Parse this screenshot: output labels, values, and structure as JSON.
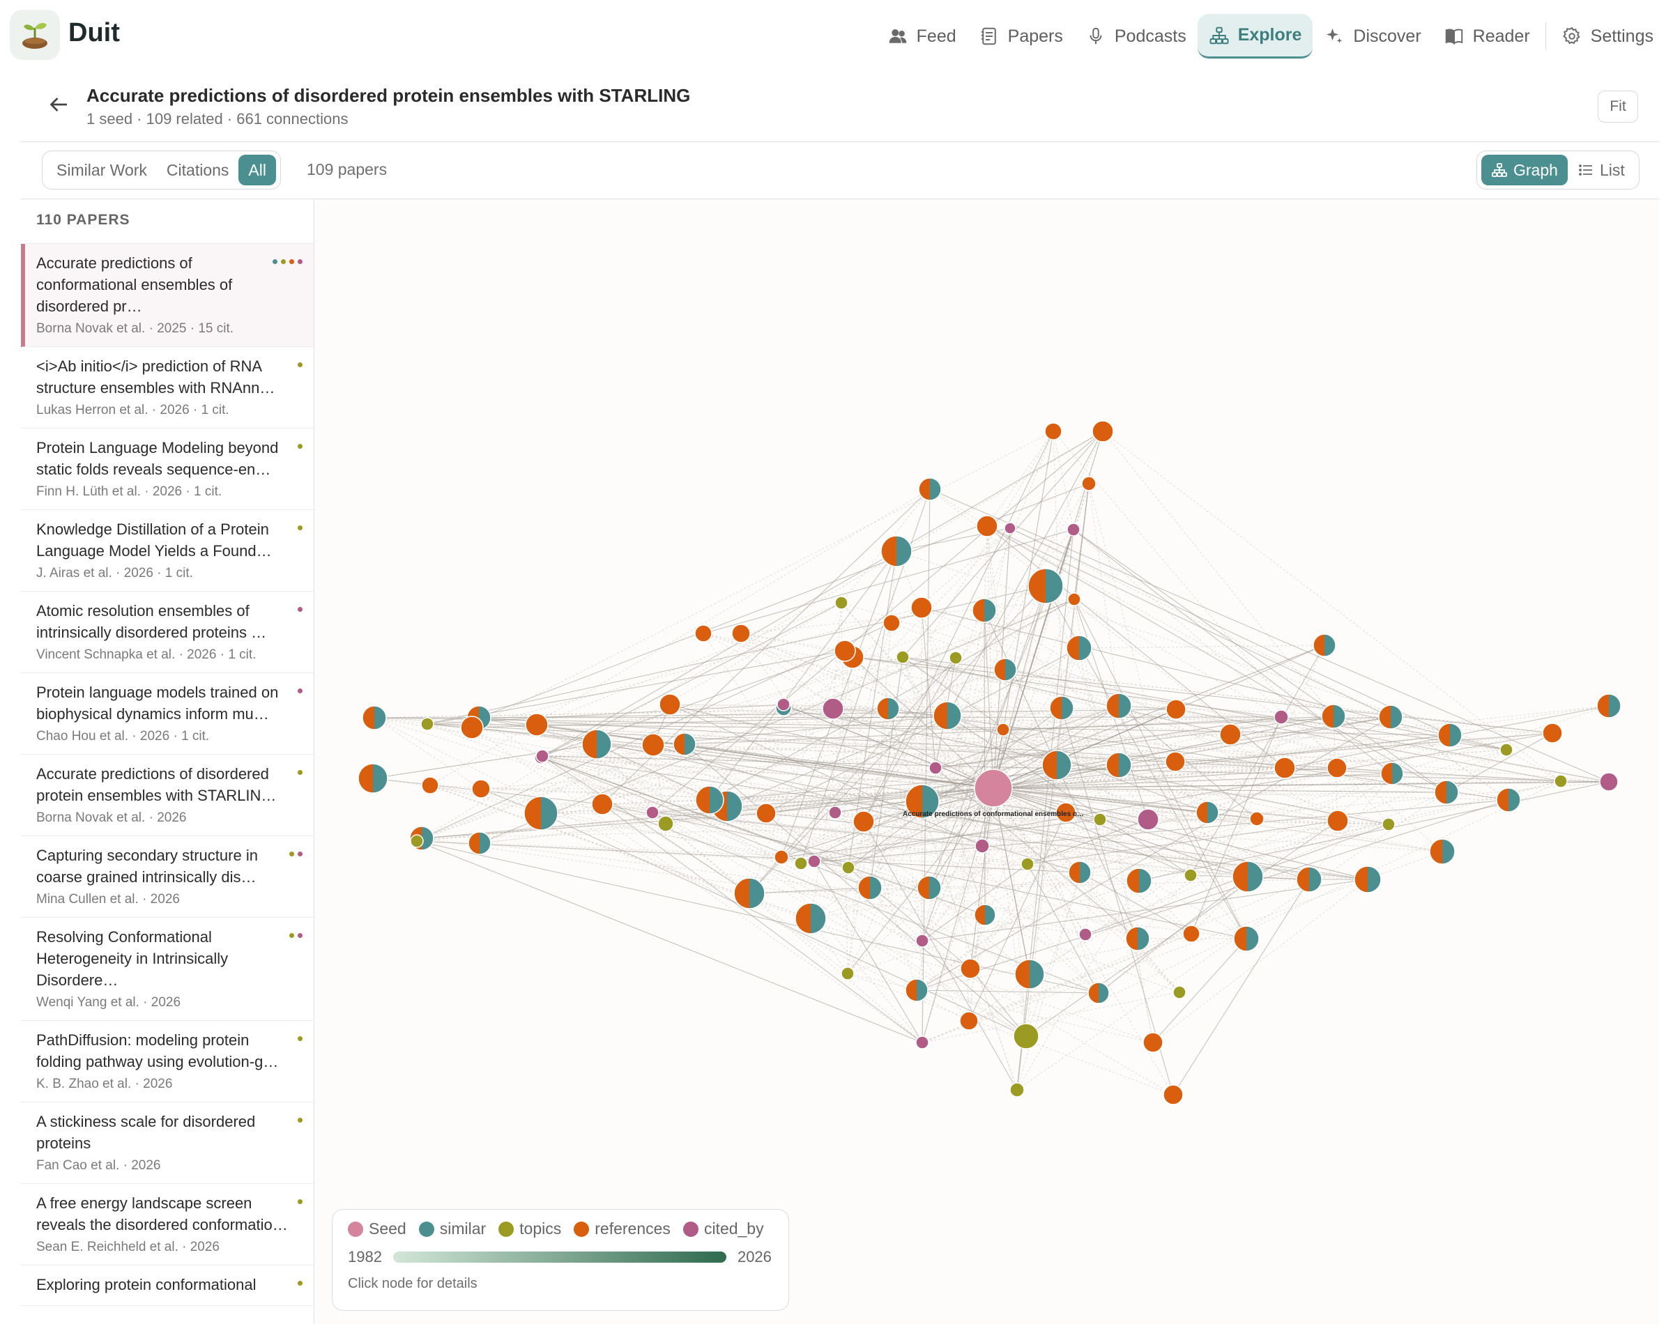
{
  "app": {
    "name": "Duit"
  },
  "nav": [
    {
      "label": "Feed",
      "icon": "users-icon"
    },
    {
      "label": "Papers",
      "icon": "papers-icon"
    },
    {
      "label": "Podcasts",
      "icon": "microphone-icon"
    },
    {
      "label": "Explore",
      "icon": "network-icon",
      "active": true
    },
    {
      "label": "Discover",
      "icon": "sparkle-icon"
    },
    {
      "label": "Reader",
      "icon": "book-icon"
    },
    {
      "label": "Settings",
      "icon": "gear-icon"
    }
  ],
  "header": {
    "title": "Accurate predictions of disordered protein ensembles with STARLING",
    "subtitle": "1 seed · 109 related · 661 connections",
    "fit_label": "Fit"
  },
  "filters": {
    "tabs": [
      "Similar Work",
      "Citations",
      "All"
    ],
    "active": "All",
    "count_label": "109 papers"
  },
  "view_toggle": {
    "graph_label": "Graph",
    "list_label": "List",
    "active": "Graph"
  },
  "sidebar": {
    "heading": "110 PAPERS",
    "papers": [
      {
        "title": "Accurate predictions of conformational ensembles of disordered pr…",
        "meta": "Borna Novak et al. · 2025 · 15 cit.",
        "dots": [
          "#4b8f90",
          "#9b9a22",
          "#d95f0e",
          "#b05c87"
        ],
        "selected": true
      },
      {
        "title": "<i>Ab initio</i> prediction of RNA structure ensembles with RNAnn…",
        "meta": "Lukas Herron et al. · 2026 · 1 cit.",
        "dots": [
          "#9b9a22"
        ]
      },
      {
        "title": "Protein Language Modeling beyond static folds reveals sequence-en…",
        "meta": "Finn H. Lüth et al. · 2026 · 1 cit.",
        "dots": [
          "#9b9a22"
        ]
      },
      {
        "title": "Knowledge Distillation of a Protein Language Model Yields a Found…",
        "meta": "J. Airas et al. · 2026 · 1 cit.",
        "dots": [
          "#9b9a22"
        ]
      },
      {
        "title": "Atomic resolution ensembles of intrinsically disordered proteins …",
        "meta": "Vincent Schnapka et al. · 2026 · 1 cit.",
        "dots": [
          "#b05c87"
        ]
      },
      {
        "title": "Protein language models trained on biophysical dynamics inform mu…",
        "meta": "Chao Hou et al. · 2026 · 1 cit.",
        "dots": [
          "#b05c87"
        ]
      },
      {
        "title": "Accurate predictions of disordered protein ensembles with STARLIN…",
        "meta": "Borna Novak et al. · 2026",
        "dots": [
          "#9b9a22"
        ]
      },
      {
        "title": "Capturing secondary structure in coarse grained intrinsically dis…",
        "meta": "Mina Cullen et al. · 2026",
        "dots": [
          "#9b9a22",
          "#b05c87"
        ]
      },
      {
        "title": "Resolving Conformational Heterogeneity in Intrinsically Disordere…",
        "meta": "Wenqi Yang et al. · 2026",
        "dots": [
          "#9b9a22",
          "#b05c87"
        ]
      },
      {
        "title": "PathDiffusion: modeling protein folding pathway using evolution-g…",
        "meta": "K. B. Zhao et al. · 2026",
        "dots": [
          "#9b9a22"
        ]
      },
      {
        "title": "A stickiness scale for disordered proteins",
        "meta": "Fan Cao et al. · 2026",
        "dots": [
          "#9b9a22"
        ]
      },
      {
        "title": "A free energy landscape screen reveals the disordered conformatio…",
        "meta": "Sean E. Reichheld et al. · 2026",
        "dots": [
          "#9b9a22"
        ]
      },
      {
        "title": "Exploring protein conformational",
        "meta": "",
        "dots": [
          "#9b9a22"
        ]
      }
    ]
  },
  "graph": {
    "seed_label": "Accurate predictions of conformational ensembles o…",
    "colors": {
      "seed": "#d4849c",
      "similar": "#4b8f90",
      "topics": "#9b9a22",
      "references": "#d95f0e",
      "cited_by": "#b05c87"
    }
  },
  "legend": {
    "items": [
      {
        "label": "Seed",
        "color": "#d4849c"
      },
      {
        "label": "similar",
        "color": "#4b8f90"
      },
      {
        "label": "topics",
        "color": "#9b9a22"
      },
      {
        "label": "references",
        "color": "#d95f0e"
      },
      {
        "label": "cited_by",
        "color": "#b05c87"
      }
    ],
    "year_start": "1982",
    "year_end": "2026",
    "hint": "Click node for details"
  }
}
